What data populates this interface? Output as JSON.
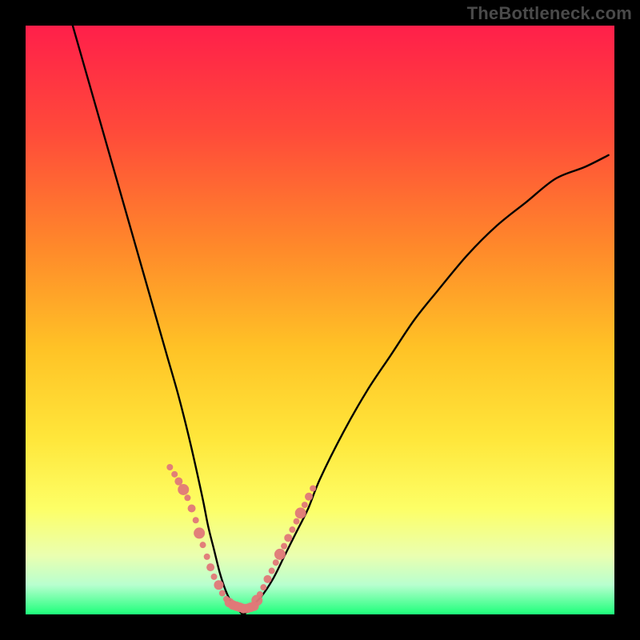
{
  "watermark": "TheBottleneck.com",
  "colors": {
    "frame": "#000000",
    "gradient_stops": [
      {
        "offset": 0.0,
        "color": "#ff1f4a"
      },
      {
        "offset": 0.18,
        "color": "#ff4a3a"
      },
      {
        "offset": 0.38,
        "color": "#ff8a2a"
      },
      {
        "offset": 0.55,
        "color": "#ffc326"
      },
      {
        "offset": 0.7,
        "color": "#ffe63a"
      },
      {
        "offset": 0.82,
        "color": "#fdff66"
      },
      {
        "offset": 0.9,
        "color": "#eaffb0"
      },
      {
        "offset": 0.95,
        "color": "#b8ffcf"
      },
      {
        "offset": 1.0,
        "color": "#1dff7a"
      }
    ],
    "curve": "#000000",
    "markers": "#e07878"
  },
  "chart_data": {
    "type": "line",
    "title": "",
    "xlabel": "",
    "ylabel": "",
    "xlim": [
      0,
      100
    ],
    "ylim": [
      0,
      100
    ],
    "grid": false,
    "series": [
      {
        "name": "bottleneck-curve",
        "x": [
          8,
          10,
          12,
          14,
          16,
          18,
          20,
          22,
          24,
          26,
          28,
          30,
          31,
          32,
          33,
          34,
          35,
          36,
          37,
          38,
          40,
          42,
          44,
          46,
          48,
          50,
          54,
          58,
          62,
          66,
          70,
          75,
          80,
          85,
          90,
          95,
          99
        ],
        "y": [
          100,
          93,
          86,
          79,
          72,
          65,
          58,
          51,
          44,
          37,
          29,
          20,
          15,
          11,
          7,
          4,
          2,
          1,
          0,
          1,
          3,
          6,
          10,
          14,
          18,
          23,
          31,
          38,
          44,
          50,
          55,
          61,
          66,
          70,
          74,
          76,
          78
        ]
      }
    ],
    "annotations": [
      {
        "name": "left-marker-cluster",
        "type": "scatter",
        "x": [
          24.5,
          25.3,
          26.0,
          26.8,
          27.5,
          28.2,
          28.9,
          29.5,
          30.1,
          30.8,
          31.4,
          32.0,
          32.8,
          33.4,
          34.1
        ],
        "y": [
          25.0,
          23.8,
          22.6,
          21.2,
          19.8,
          18.0,
          16.0,
          13.8,
          11.8,
          9.8,
          8.0,
          6.4,
          5.0,
          3.6,
          2.6
        ],
        "sizes": [
          4.0,
          4.0,
          5.0,
          7.0,
          4.0,
          5.0,
          4.0,
          7.0,
          4.0,
          4.0,
          5.0,
          4.0,
          6.0,
          4.0,
          4.0
        ]
      },
      {
        "name": "bottom-marker-cluster",
        "type": "scatter",
        "x": [
          34.6,
          35.2,
          35.8,
          36.4,
          37.0,
          37.6,
          38.2,
          38.8
        ],
        "y": [
          2.0,
          1.6,
          1.4,
          1.2,
          1.0,
          1.0,
          1.2,
          1.4
        ],
        "sizes": [
          6.0,
          6.0,
          6.0,
          6.0,
          6.0,
          6.0,
          6.0,
          6.0
        ]
      },
      {
        "name": "right-marker-cluster",
        "type": "scatter",
        "x": [
          39.3,
          39.8,
          40.4,
          41.1,
          41.8,
          42.5,
          43.2,
          43.9,
          44.6,
          45.3,
          46.0,
          46.7,
          47.4,
          48.1,
          48.8
        ],
        "y": [
          2.4,
          3.4,
          4.6,
          6.0,
          7.4,
          8.8,
          10.2,
          11.6,
          13.0,
          14.4,
          15.8,
          17.2,
          18.6,
          20.0,
          21.4
        ],
        "sizes": [
          7.0,
          4.0,
          4.0,
          5.0,
          4.0,
          4.0,
          7.0,
          4.0,
          5.0,
          4.0,
          4.0,
          7.0,
          4.0,
          5.0,
          4.0
        ]
      }
    ]
  }
}
